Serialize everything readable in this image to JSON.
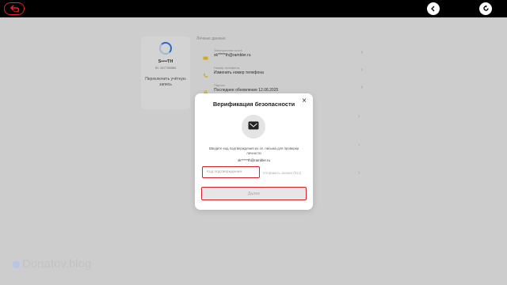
{
  "colors": {
    "accent_red": "#d61f26",
    "topbar": "#000000",
    "spinner_blue": "#2c7be5"
  },
  "topbar": {
    "back_icon": "back-arrow-icon",
    "left_icon": "chevron-left-icon",
    "right_icon": "refresh-icon"
  },
  "profile": {
    "name": "S••••TH",
    "id": "ID: 347745584",
    "switch_label": "Переключить учётную запись"
  },
  "section": {
    "title": "Личные данные",
    "rows": [
      {
        "label": "Электронная почта",
        "value": "sk*****th@rambler.ru",
        "icon": "mail-icon"
      },
      {
        "label": "Номер телефона",
        "value": "Изменить номер телефона",
        "icon": "phone-icon"
      },
      {
        "label": "Пароль",
        "value": "Последнее обновление 12.06.2025",
        "icon": "lock-icon"
      }
    ]
  },
  "modal": {
    "title": "Верификация безопасности",
    "close_icon": "close-icon",
    "mail_icon": "envelope-icon",
    "instruction": "Введите код подтверждения из эл. письма для проверки личности",
    "email": "sk*****th@rambler.ru",
    "code_placeholder": "Код подтверждения",
    "resend": "Отправить заново (51s)",
    "next_label": "Далее"
  },
  "watermark": "Donatov.blog"
}
